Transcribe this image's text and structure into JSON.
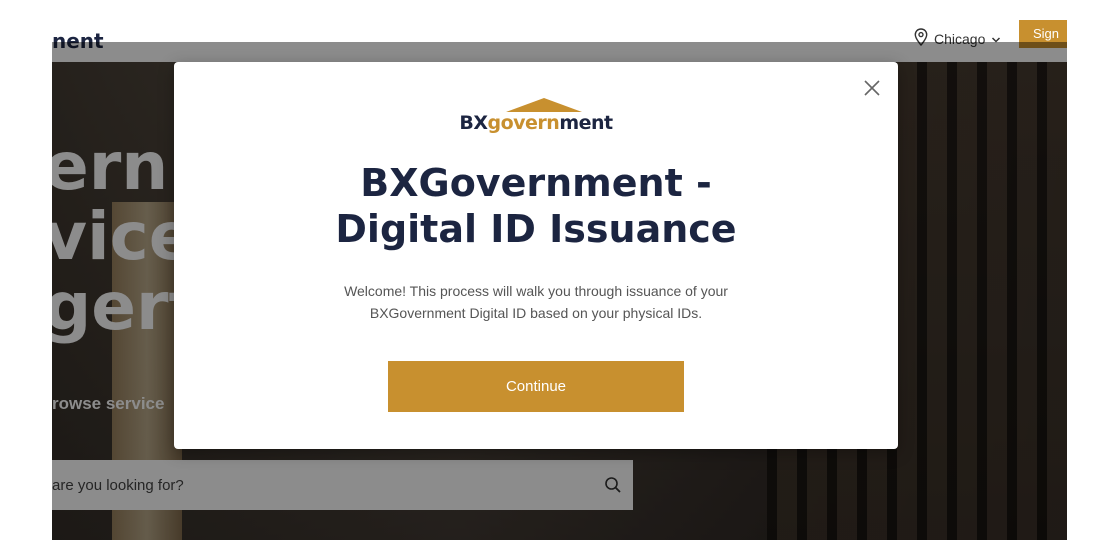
{
  "header": {
    "brand_fragment": "nent",
    "location": "Chicago",
    "signin_label": "Sign"
  },
  "hero": {
    "title_lines": [
      "ern",
      "vice",
      "gert"
    ],
    "subtitle": "rowse service",
    "search": {
      "placeholder": "are you looking for?"
    }
  },
  "modal": {
    "logo": {
      "prefix": "BX",
      "gold": "govern",
      "suffix": "ment"
    },
    "title_line1": "BXGovernment -",
    "title_line2": "Digital ID Issuance",
    "desc_line1": "Welcome! This process will walk you through issuance of your",
    "desc_line2": "BXGovernment Digital ID based on your physical IDs.",
    "continue_label": "Continue"
  },
  "colors": {
    "accent": "#c8902f",
    "navy": "#1c2541",
    "text_muted": "#555555"
  },
  "icons": {
    "location": "map-pin-icon",
    "dropdown": "chevron-down-icon",
    "search": "search-icon",
    "close": "close-icon"
  }
}
